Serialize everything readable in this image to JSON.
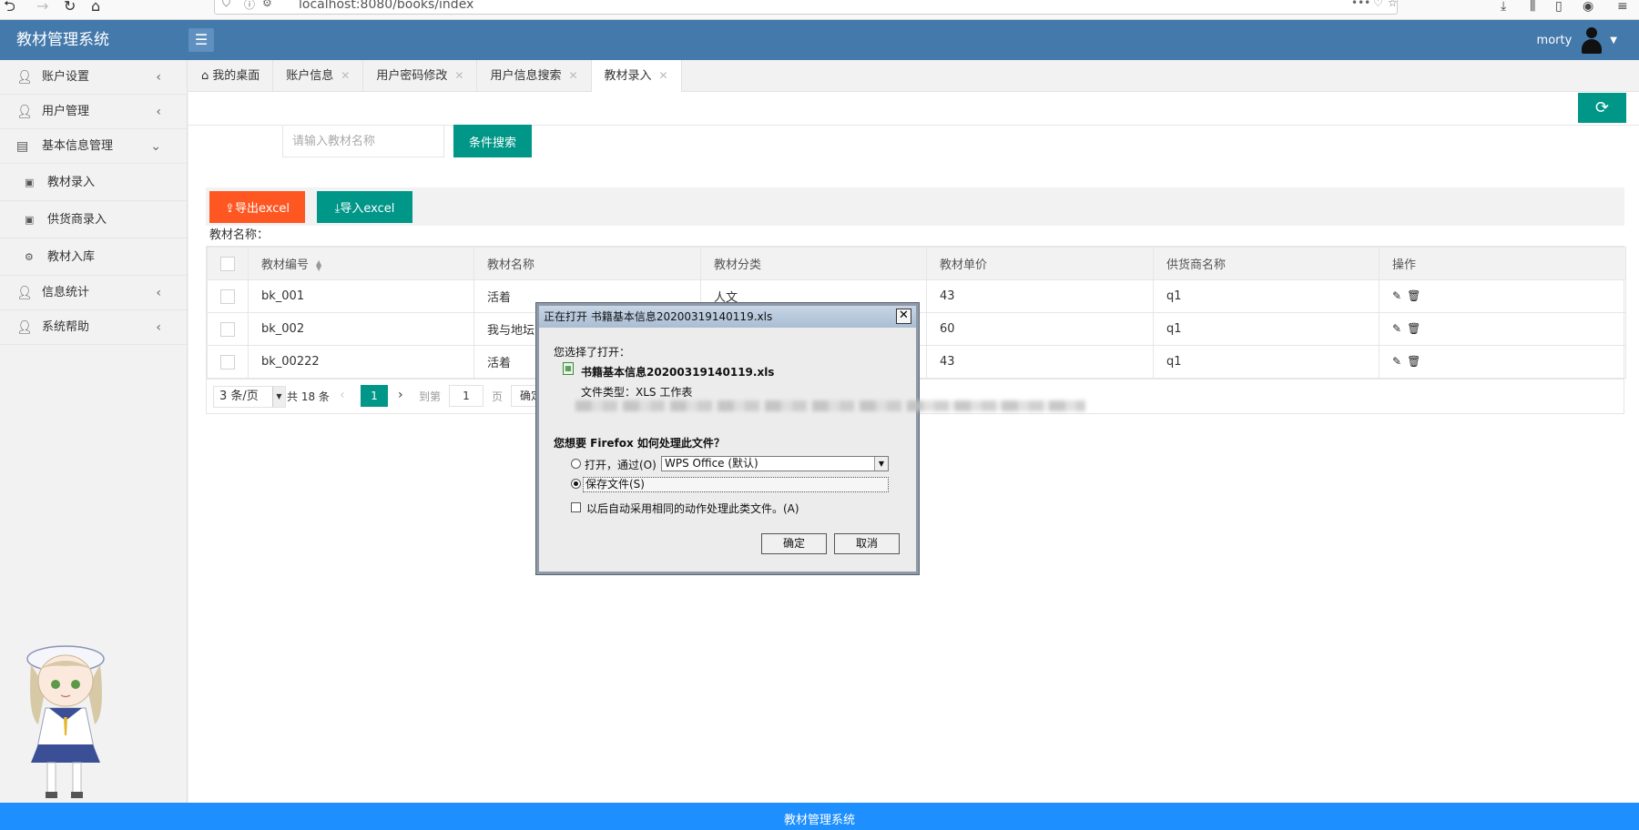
{
  "browser": {
    "url": "localhost:8080/books/index"
  },
  "header": {
    "app_title": "教材管理系统",
    "username": "morty"
  },
  "sidebar": {
    "items": [
      {
        "label": "账户设置"
      },
      {
        "label": "用户管理"
      },
      {
        "label": "基本信息管理"
      },
      {
        "label": "教材录入"
      },
      {
        "label": "供货商录入"
      },
      {
        "label": "教材入库"
      },
      {
        "label": "信息统计"
      },
      {
        "label": "系统帮助"
      }
    ]
  },
  "tabs": [
    {
      "label": "我的桌面"
    },
    {
      "label": "账户信息"
    },
    {
      "label": "用户密码修改"
    },
    {
      "label": "用户信息搜索"
    },
    {
      "label": "教材录入"
    }
  ],
  "search": {
    "label": "教材名称：",
    "placeholder": "请输入教材名称",
    "button": "条件搜索"
  },
  "toolbar": {
    "export_label": "导出excel",
    "import_label": "导入excel"
  },
  "table": {
    "headers": [
      "教材编号",
      "教材名称",
      "教材分类",
      "教材单价",
      "供货商名称",
      "操作"
    ],
    "rows": [
      {
        "id": "bk_001",
        "name": "活着",
        "category": "人文",
        "price": "43",
        "supplier": "q1"
      },
      {
        "id": "bk_002",
        "name": "我与地坛",
        "category": "",
        "price": "60",
        "supplier": "q1"
      },
      {
        "id": "bk_00222",
        "name": "活着",
        "category": "",
        "price": "43",
        "supplier": "q1"
      }
    ]
  },
  "pager": {
    "page_size": "3 条/页",
    "total": "共 18 条",
    "current": "1",
    "goto_label": "到第",
    "goto_value": "1",
    "page_label": "页",
    "ok_label": "确定"
  },
  "dialog": {
    "title": "正在打开 书籍基本信息20200319140119.xls",
    "you_chose": "您选择了打开：",
    "filename": "书籍基本信息20200319140119.xls",
    "filetype_label": "文件类型：",
    "filetype_value": "XLS 工作表",
    "question": "您想要 Firefox 如何处理此文件？",
    "open_with_label": "打开，通过(O)",
    "open_with_app": "WPS Office (默认)",
    "save_label": "保存文件(S)",
    "auto_label": "以后自动采用相同的动作处理此类文件。(A)",
    "ok": "确定",
    "cancel": "取消"
  },
  "footer": {
    "text": "教材管理系统"
  },
  "colors": {
    "header": "#4479ab",
    "primary": "#009688",
    "danger": "#ff5722",
    "footer": "#1e8fff"
  }
}
